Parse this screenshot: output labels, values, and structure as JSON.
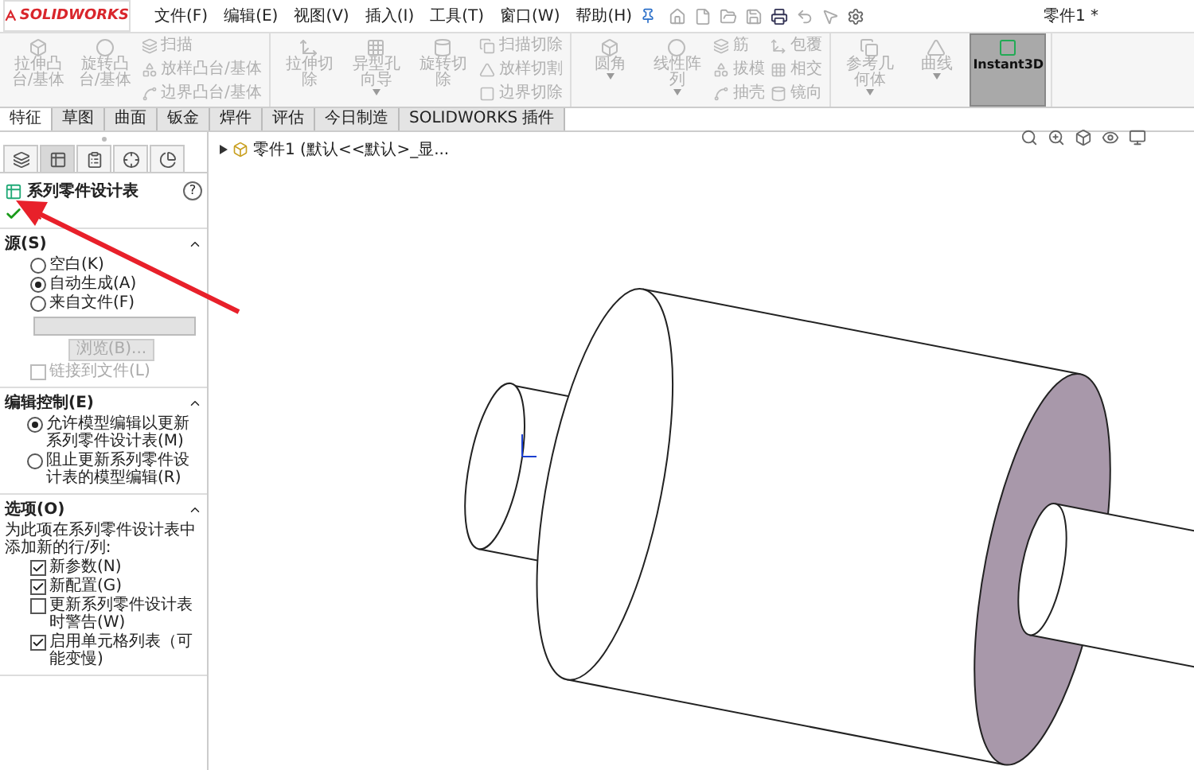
{
  "app": {
    "logo": "SOLIDWORKS",
    "menu": [
      "文件(F)",
      "编辑(E)",
      "视图(V)",
      "插入(I)",
      "工具(T)",
      "窗口(W)",
      "帮助(H)"
    ],
    "document_title": "零件1 *"
  },
  "ribbon": {
    "groups": [
      {
        "items": [
          {
            "kind": "large",
            "label": "拉伸凸台/基体",
            "disabled": true,
            "selected": false,
            "dropdown": false
          },
          {
            "kind": "large",
            "label": "旋转凸台/基体",
            "disabled": true,
            "selected": false,
            "dropdown": false
          },
          {
            "kind": "stack",
            "items": [
              {
                "label": "扫描",
                "disabled": true
              },
              {
                "label": "放样凸台/基体",
                "disabled": true
              },
              {
                "label": "边界凸台/基体",
                "disabled": true
              }
            ]
          }
        ]
      },
      {
        "items": [
          {
            "kind": "large",
            "label": "拉伸切除",
            "disabled": true,
            "selected": false,
            "dropdown": false
          },
          {
            "kind": "large",
            "label": "异型孔向导",
            "disabled": true,
            "selected": false,
            "dropdown": true
          },
          {
            "kind": "large",
            "label": "旋转切除",
            "disabled": true,
            "selected": false,
            "dropdown": false
          },
          {
            "kind": "stack",
            "items": [
              {
                "label": "扫描切除",
                "disabled": true
              },
              {
                "label": "放样切割",
                "disabled": true
              },
              {
                "label": "边界切除",
                "disabled": true
              }
            ]
          }
        ]
      },
      {
        "items": [
          {
            "kind": "large",
            "label": "圆角",
            "disabled": true,
            "selected": false,
            "dropdown": true
          },
          {
            "kind": "large",
            "label": "线性阵列",
            "disabled": true,
            "selected": false,
            "dropdown": true
          },
          {
            "kind": "stack",
            "items": [
              {
                "label": "筋",
                "disabled": true
              },
              {
                "label": "拔模",
                "disabled": true
              },
              {
                "label": "抽壳",
                "disabled": true
              }
            ]
          },
          {
            "kind": "stack",
            "items": [
              {
                "label": "包覆",
                "disabled": true
              },
              {
                "label": "相交",
                "disabled": true
              },
              {
                "label": "镜向",
                "disabled": true
              }
            ]
          }
        ]
      },
      {
        "items": [
          {
            "kind": "large",
            "label": "参考几何体",
            "disabled": true,
            "selected": false,
            "dropdown": true
          },
          {
            "kind": "large",
            "label": "曲线",
            "disabled": true,
            "selected": false,
            "dropdown": true
          },
          {
            "kind": "large",
            "label": "Instant3D",
            "disabled": false,
            "selected": true,
            "dropdown": false
          }
        ]
      }
    ]
  },
  "command_tabs": [
    {
      "label": "特征",
      "selected": true
    },
    {
      "label": "草图",
      "selected": false
    },
    {
      "label": "曲面",
      "selected": false
    },
    {
      "label": "钣金",
      "selected": false
    },
    {
      "label": "焊件",
      "selected": false
    },
    {
      "label": "评估",
      "selected": false
    },
    {
      "label": "今日制造",
      "selected": false
    },
    {
      "label": "SOLIDWORKS 插件",
      "selected": false
    }
  ],
  "panel": {
    "tabs": [
      {
        "selected": false
      },
      {
        "selected": true
      },
      {
        "selected": false
      },
      {
        "selected": false
      },
      {
        "selected": false
      }
    ],
    "title": "系列零件设计表",
    "help": "?",
    "sections": [
      {
        "kind": "source",
        "title": "源(S)",
        "expanded": true,
        "radios": [
          {
            "label": "空白(K)",
            "selected": false
          },
          {
            "label": "自动生成(A)",
            "selected": true
          },
          {
            "label": "来自文件(F)",
            "selected": false
          }
        ],
        "browse": "浏览(B)...",
        "link": {
          "label": "链接到文件(L)",
          "checked": false,
          "disabled": true
        }
      },
      {
        "kind": "edit",
        "title": "编辑控制(E)",
        "expanded": true,
        "radios": [
          {
            "label": "允许模型编辑以更新系列零件设计表(M)",
            "selected": true
          },
          {
            "label": "阻止更新系列零件设计表的模型编辑(R)",
            "selected": false
          }
        ]
      },
      {
        "kind": "options",
        "title": "选项(O)",
        "expanded": true,
        "note": "为此项在系列零件设计表中添加新的行/列:",
        "checks": [
          {
            "label": "新参数(N)",
            "checked": true
          },
          {
            "label": "新配置(G)",
            "checked": true
          },
          {
            "label": "更新系列零件设计表时警告(W)",
            "checked": false
          },
          {
            "label": "启用单元格列表（可能变慢)",
            "checked": true
          }
        ]
      }
    ]
  },
  "tree": {
    "label": "零件1  (默认<<默认>_显...",
    "expanded": false
  }
}
